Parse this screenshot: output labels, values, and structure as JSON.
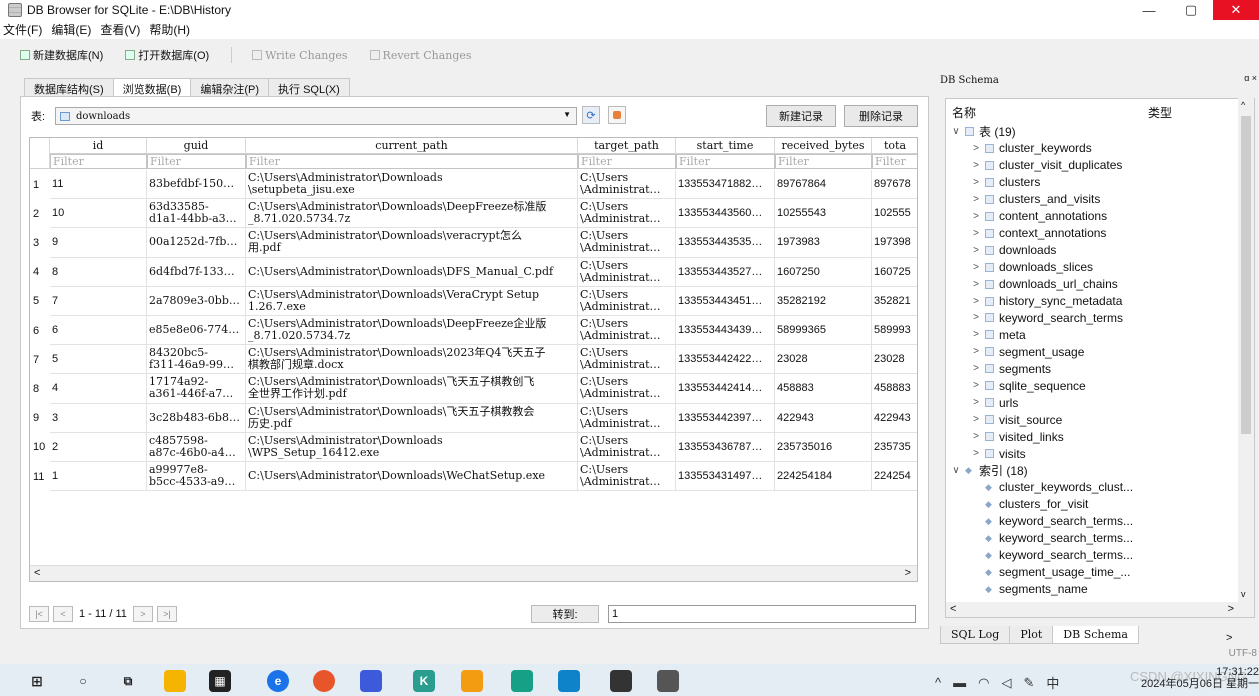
{
  "window": {
    "title": "DB Browser for SQLite - E:\\DB\\History",
    "minimize": "—",
    "maximize": "▢",
    "close": "✕"
  },
  "menu": [
    "文件(F)",
    "编辑(E)",
    "查看(V)",
    "帮助(H)"
  ],
  "toolbar": {
    "new_db": "新建数据库(N)",
    "open_db": "打开数据库(O)",
    "write": "Write Changes",
    "revert": "Revert Changes"
  },
  "tabs": [
    "数据库结构(S)",
    "浏览数据(B)",
    "编辑杂注(P)",
    "执行 SQL(X)"
  ],
  "browse": {
    "table_label": "表:",
    "table_name": "downloads",
    "new_record": "新建记录",
    "delete_record": "删除记录",
    "columns": [
      "id",
      "guid",
      "current_path",
      "target_path",
      "start_time",
      "received_bytes",
      "tota"
    ],
    "filter_placeholder": "Filter",
    "rows": [
      {
        "n": "1",
        "id": "11",
        "guid": "83befdbf-150…",
        "current_path": "C:\\Users\\Administrator\\Downloads\n\\setupbeta_jisu.exe",
        "target_path": "C:\\Users\n\\Administrat…",
        "start_time": "133553471882…",
        "received_bytes": "89767864",
        "total": "897678"
      },
      {
        "n": "2",
        "id": "10",
        "guid": "63d33585-\nd1a1-44bb-a3…",
        "current_path": "C:\\Users\\Administrator\\Downloads\\DeepFreeze标准版\n_8.71.020.5734.7z",
        "target_path": "C:\\Users\n\\Administrat…",
        "start_time": "133553443560…",
        "received_bytes": "10255543",
        "total": "102555"
      },
      {
        "n": "3",
        "id": "9",
        "guid": "00a1252d-7fb…",
        "current_path": "C:\\Users\\Administrator\\Downloads\\veracrypt怎么\n用.pdf",
        "target_path": "C:\\Users\n\\Administrat…",
        "start_time": "133553443535…",
        "received_bytes": "1973983",
        "total": "197398"
      },
      {
        "n": "4",
        "id": "8",
        "guid": "6d4fbd7f-133…",
        "current_path": "C:\\Users\\Administrator\\Downloads\\DFS_Manual_C.pdf",
        "target_path": "C:\\Users\n\\Administrat…",
        "start_time": "133553443527…",
        "received_bytes": "1607250",
        "total": "160725"
      },
      {
        "n": "5",
        "id": "7",
        "guid": "2a7809e3-0bb…",
        "current_path": "C:\\Users\\Administrator\\Downloads\\VeraCrypt Setup\n1.26.7.exe",
        "target_path": "C:\\Users\n\\Administrat…",
        "start_time": "133553443451…",
        "received_bytes": "35282192",
        "total": "352821"
      },
      {
        "n": "6",
        "id": "6",
        "guid": "e85e8e06-774…",
        "current_path": "C:\\Users\\Administrator\\Downloads\\DeepFreeze企业版\n_8.71.020.5734.7z",
        "target_path": "C:\\Users\n\\Administrat…",
        "start_time": "133553443439…",
        "received_bytes": "58999365",
        "total": "589993"
      },
      {
        "n": "7",
        "id": "5",
        "guid": "84320bc5-\nf311-46a9-99…",
        "current_path": "C:\\Users\\Administrator\\Downloads\\2023年Q4飞天五子\n棋教部门规章.docx",
        "target_path": "C:\\Users\n\\Administrat…",
        "start_time": "133553442422…",
        "received_bytes": "23028",
        "total": "23028"
      },
      {
        "n": "8",
        "id": "4",
        "guid": "17174a92-\na361-446f-a7…",
        "current_path": "C:\\Users\\Administrator\\Downloads\\飞天五子棋教创飞\n全世界工作计划.pdf",
        "target_path": "C:\\Users\n\\Administrat…",
        "start_time": "133553442414…",
        "received_bytes": "458883",
        "total": "458883"
      },
      {
        "n": "9",
        "id": "3",
        "guid": "3c28b483-6b8…",
        "current_path": "C:\\Users\\Administrator\\Downloads\\飞天五子棋教教会\n历史.pdf",
        "target_path": "C:\\Users\n\\Administrat…",
        "start_time": "133553442397…",
        "received_bytes": "422943",
        "total": "422943"
      },
      {
        "n": "10",
        "id": "2",
        "guid": "c4857598-\na87c-46b0-a4…",
        "current_path": "C:\\Users\\Administrator\\Downloads\n\\WPS_Setup_16412.exe",
        "target_path": "C:\\Users\n\\Administrat…",
        "start_time": "133553436787…",
        "received_bytes": "235735016",
        "total": "235735"
      },
      {
        "n": "11",
        "id": "1",
        "guid": "a99977e8-\nb5cc-4533-a9…",
        "current_path": "C:\\Users\\Administrator\\Downloads\\WeChatSetup.exe",
        "target_path": "C:\\Users\n\\Administrat…",
        "start_time": "133553431497…",
        "received_bytes": "224254184",
        "total": "224254"
      }
    ],
    "page_info": "1 - 11 / 11",
    "goto_label": "转到:",
    "goto_value": "1"
  },
  "schema": {
    "dock_title": "DB Schema",
    "col_name": "名称",
    "col_type": "类型",
    "tables_label": "表 (19)",
    "tables": [
      "cluster_keywords",
      "cluster_visit_duplicates",
      "clusters",
      "clusters_and_visits",
      "content_annotations",
      "context_annotations",
      "downloads",
      "downloads_slices",
      "downloads_url_chains",
      "history_sync_metadata",
      "keyword_search_terms",
      "meta",
      "segment_usage",
      "segments",
      "sqlite_sequence",
      "urls",
      "visit_source",
      "visited_links",
      "visits"
    ],
    "indexes_label": "索引 (18)",
    "indexes": [
      "cluster_keywords_clust...",
      "clusters_for_visit",
      "keyword_search_terms...",
      "keyword_search_terms...",
      "keyword_search_terms...",
      "segment_usage_time_...",
      "segments_name"
    ]
  },
  "dock_tabs": [
    "SQL Log",
    "Plot",
    "DB Schema"
  ],
  "status": {
    "encoding": "UTF-8"
  },
  "taskbar": {
    "time": "17:31:22",
    "date": "2024年05月06日 星期一",
    "watermark": "CSDN @XIXINGNG"
  }
}
